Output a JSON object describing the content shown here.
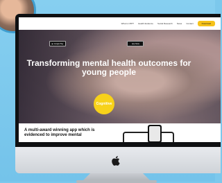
{
  "site": {
    "nav": [
      "What is CBT?",
      "Health Evidence",
      "Social Research",
      "News",
      "Contact"
    ],
    "nav_button": "Download",
    "hero_title": "Transforming mental health outcomes for young people",
    "cta_label": "Cognitive",
    "app_store_badges": [
      "Google Play",
      "App Store"
    ],
    "info_heading": "A multi-award winning app which is evidenced to improve mental"
  },
  "colors": {
    "background": "#7cc8ec",
    "accent": "#f6c21a"
  }
}
